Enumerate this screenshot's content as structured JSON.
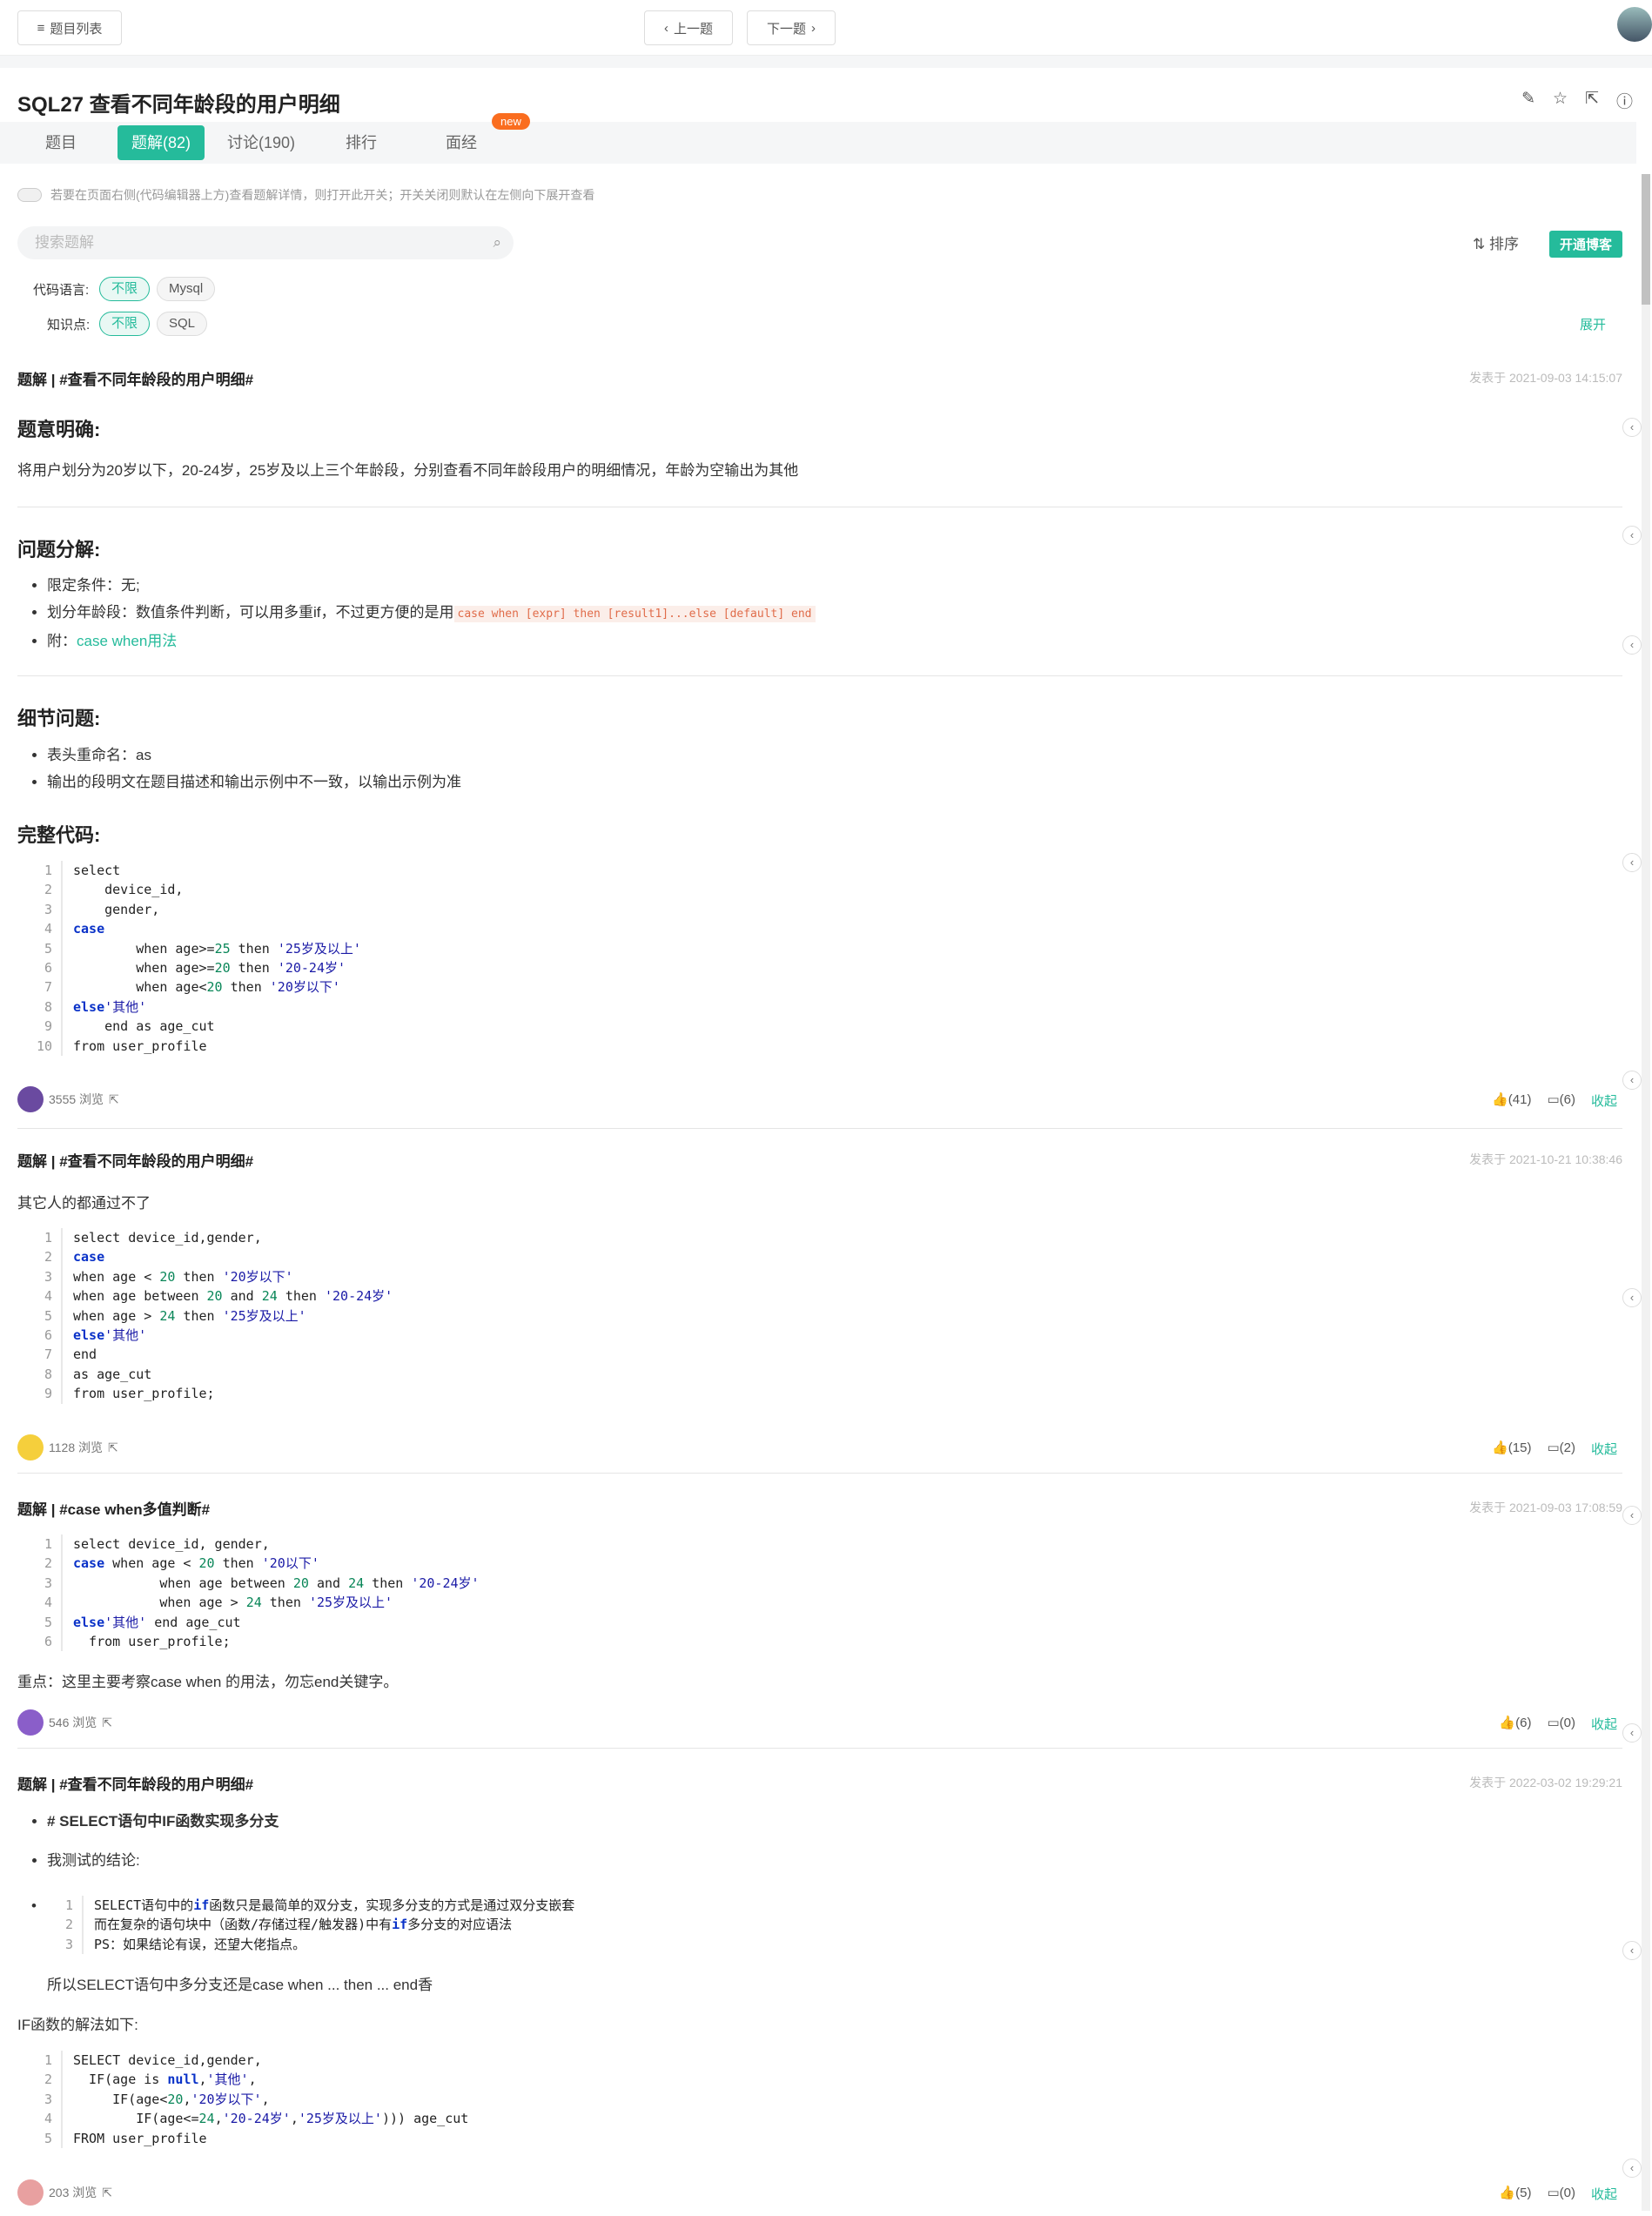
{
  "nav": {
    "list": "题目列表",
    "prev": "上一题",
    "next": "下一题"
  },
  "problem": {
    "title": "SQL27  查看不同年龄段的用户明细"
  },
  "tabs": [
    "题目",
    "题解(82)",
    "讨论(190)",
    "排行",
    "面经"
  ],
  "new_badge": "new",
  "hint": "若要在页面右侧(代码编辑器上方)查看题解详情，则打开此开关；开关关闭则默认在左侧向下展开查看",
  "search": {
    "placeholder": "搜索题解"
  },
  "sort": "排序",
  "blog": "开通博客",
  "filters": {
    "lang_label": "代码语言:",
    "kp_label": "知识点:",
    "all": "不限",
    "mysql": "Mysql",
    "sql": "SQL",
    "expand": "展开"
  },
  "posts": [
    {
      "title": "题解 | #查看不同年龄段的用户明细#",
      "date": "发表于 2021-09-03 14:15:07",
      "h_intent": "题意明确:",
      "intent": "将用户划分为20岁以下，20-24岁，25岁及以上三个年龄段，分别查看不同年龄段用户的明细情况，年龄为空输出为其他",
      "h_break": "问题分解:",
      "b1": "限定条件：无;",
      "b2": "划分年龄段：数值条件判断，可以用多重if，不过更方便的是用",
      "b2code": "case when [expr] then [result1]...else [default] end",
      "b3": "附：",
      "b3link": "case when用法",
      "h_detail": "细节问题:",
      "d1": "表头重命名：as",
      "d2": "输出的段明文在题目描述和输出示例中不一致，以输出示例为准",
      "h_code": "完整代码:",
      "views": "3555 浏览",
      "likes": "(41)",
      "comments": "(6)",
      "collect": "收起"
    },
    {
      "title": "题解 | #查看不同年龄段的用户明细#",
      "date": "发表于 2021-10-21 10:38:46",
      "p1": "其它人的都通过不了",
      "views": "1128 浏览",
      "likes": "(15)",
      "comments": "(2)",
      "collect": "收起"
    },
    {
      "title": "题解 | #case when多值判断#",
      "date": "发表于 2021-09-03 17:08:59",
      "p1": "重点：这里主要考察case when 的用法，勿忘end关键字。",
      "views": "546 浏览",
      "likes": "(6)",
      "comments": "(0)",
      "collect": "收起"
    },
    {
      "title": "题解 | #查看不同年龄段的用户明细#",
      "date": "发表于 2022-03-02 19:29:21",
      "h1": "# SELECT语句中IF函数实现多分支",
      "l2": "我测试的结论:",
      "p1": "所以SELECT语句中多分支还是case when ... then ... end香",
      "p2": "IF函数的解法如下:",
      "views": "203 浏览",
      "likes": "(5)",
      "comments": "(0)",
      "collect": "收起"
    }
  ]
}
